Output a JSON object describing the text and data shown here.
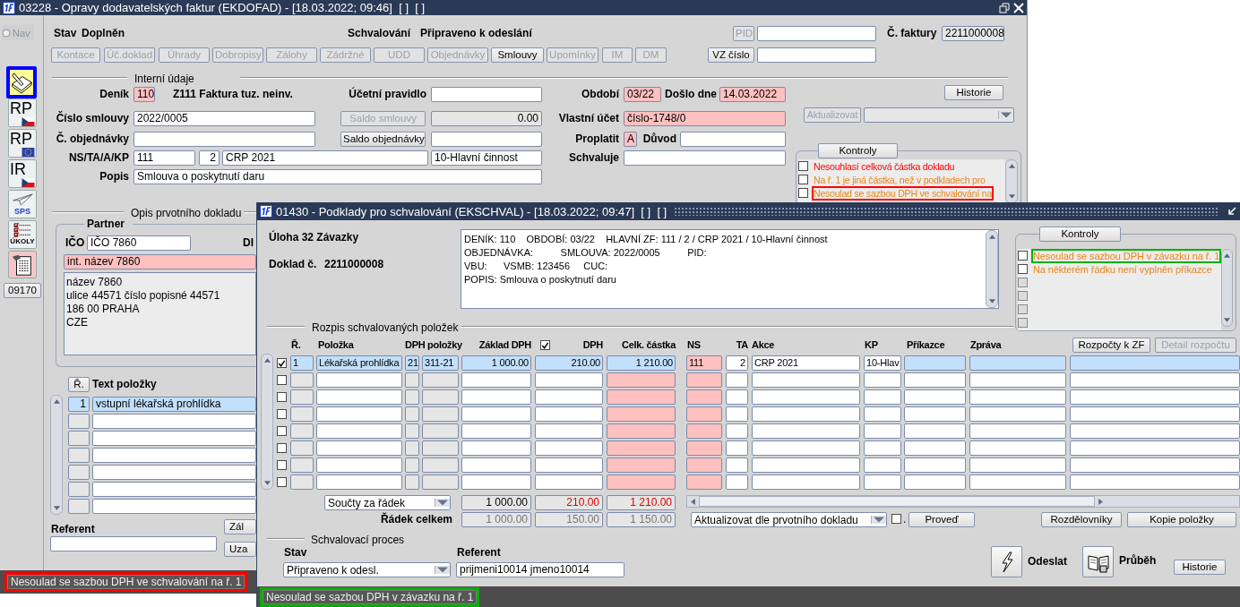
{
  "main_window": {
    "title": "03228 - Opravy dodavatelských faktur (EKDOFAD) - [18.03.2022; 09:46]  [ ]  [ ]",
    "highlight": {
      "color": "#ff0000"
    },
    "nav": {
      "label": "Nav",
      "disabled": true
    },
    "toolbar": [
      {
        "kind": "edit",
        "selected": true
      },
      {
        "kind": "czflag",
        "label": "RP",
        "selected": false
      },
      {
        "kind": "euflag",
        "label": "RP",
        "selected": false
      },
      {
        "kind": "czflag",
        "label": "IR",
        "selected": false
      },
      {
        "kind": "plane",
        "label": "SPS",
        "selected": false
      },
      {
        "kind": "tasks",
        "label": "ÚKOLY",
        "selected": false
      },
      {
        "kind": "document",
        "selected": false
      }
    ],
    "code_button": "09170",
    "stav": {
      "label": "Stav",
      "value": "Doplněn"
    },
    "schvalovani": {
      "label": "Schvalování",
      "value": "Připraveno k odeslání"
    },
    "pid": {
      "label": "PID",
      "disabled": true
    },
    "faktura": {
      "label": "Č. faktury",
      "value": "2211000008"
    },
    "vz_cislo": {
      "label": "VZ číslo",
      "disabled": false
    },
    "buttons": [
      {
        "label": "Kontace",
        "disabled": true
      },
      {
        "label": "Úč.doklad",
        "disabled": true
      },
      {
        "label": "Úhrady",
        "disabled": true
      },
      {
        "label": "Dobropisy",
        "disabled": true
      },
      {
        "label": "Zálohy",
        "disabled": true
      },
      {
        "label": "Zádržné",
        "disabled": true
      },
      {
        "label": "UDD",
        "disabled": true
      },
      {
        "label": "Objednávky",
        "disabled": true
      },
      {
        "label": "Smlouvy",
        "disabled": false
      },
      {
        "label": "Upomínky",
        "disabled": true
      },
      {
        "label": "IM",
        "disabled": true
      },
      {
        "label": "DM",
        "disabled": true
      }
    ],
    "section_internal": "Interní údaje",
    "denik": {
      "label": "Deník",
      "value": "110",
      "required": true,
      "description": "Z111 Faktura tuz. neinv."
    },
    "ucetni_pravidlo": {
      "label": "Účetní pravidlo"
    },
    "cislo_smlouvy": {
      "label": "Číslo smlouvy",
      "value": "2022/0005"
    },
    "saldo_smlouvy": {
      "label": "Saldo smlouvy",
      "value": "0.00",
      "disabled": true
    },
    "c_objednavky": {
      "label": "Č. objednávky"
    },
    "saldo_objednavky": {
      "label": "Saldo objednávky",
      "disabled": false
    },
    "ns_ta_a_kp": {
      "label": "NS/TA/A/KP",
      "values": [
        "111",
        "2",
        "CRP 2021",
        "10-Hlavní činnost"
      ]
    },
    "popis": {
      "label": "Popis",
      "value": "Smlouva o poskytnutí daru"
    },
    "obdobi": {
      "label": "Období",
      "value": "03/22",
      "required": true
    },
    "doslo_dne": {
      "label": "Došlo dne",
      "value": "14.03.2022",
      "required": true
    },
    "vlastni_ucet": {
      "label": "Vlastní účet",
      "value": "číslo-1748/0",
      "required": true
    },
    "proplatit": {
      "label": "Proplatit",
      "value": "A",
      "required": true
    },
    "duvod": {
      "label": "Důvod"
    },
    "schvaluje": {
      "label": "Schvaluje"
    },
    "historie_button": "Historie",
    "aktualizovat": {
      "label": "Aktualizovat",
      "disabled": true
    },
    "kontroly": {
      "button": "Kontroly",
      "items": [
        {
          "text": "Nesouhlasí celková částka dokladu",
          "color": "#ff0000",
          "checked": false,
          "disabled": false,
          "highlighted": false
        },
        {
          "text": "Na ř. 1 je jiná částka, než v podkladech pro",
          "color": "#e8861a",
          "checked": false,
          "disabled": false,
          "highlighted": false
        },
        {
          "text": "Nesoulad se sazbou DPH ve schvalování na",
          "color": "#e8861a",
          "checked": false,
          "disabled": false,
          "highlighted": true
        }
      ]
    },
    "section_opis": "Opis prvotního dokladu",
    "partner": {
      "title": "Partner",
      "ico_label": "IČO",
      "ico": "IČO 7860",
      "dic_label": "DI",
      "name": "int. název 7860",
      "required": true,
      "address": [
        "název 7860",
        "ulice 44571 číslo popisné 44571",
        "186 00 PRAHA",
        "CZE"
      ]
    },
    "items": {
      "columns": [
        "Ř.",
        "Text položky"
      ],
      "rows": [
        {
          "number": "1",
          "text": "vstupní lékařská prohlídka",
          "selected": true
        },
        {
          "selected": false
        },
        {
          "selected": false
        },
        {
          "selected": false
        },
        {
          "selected": false
        },
        {
          "selected": false
        },
        {
          "selected": false
        }
      ]
    },
    "referent_label": "Referent",
    "side_buttons": [
      "Zál",
      "Uza"
    ],
    "status_bar": {
      "text": "Nesoulad se sazbou DPH ve schvalování na ř. 1",
      "highlighted": true
    }
  },
  "approval_window": {
    "title": "01430 - Podklady pro schvalování (EKSCHVAL) - [18.03.2022; 09:47]  [ ]  [ ]",
    "highlight": {
      "color": "#00b000"
    },
    "task": "Úloha 32 Závazky",
    "doklad": {
      "label": "Doklad č.",
      "value": "2211000008"
    },
    "info_lines": [
      "DENÍK: 110    OBDOBÍ: 03/22    HLAVNÍ ZF: 111 / 2 / CRP 2021 / 10-Hlavní činnost",
      "OBJEDNÁVKA:          SMLOUVA: 2022/0005          PID:",
      "VBU:      VSMB: 123456     CUC:",
      "POPIS: Smlouva o poskytnutí daru"
    ],
    "kontroly": {
      "button": "Kontroly",
      "items": [
        {
          "text": "Nesoulad se sazbou DPH v závazku na ř. 1",
          "color": "#e8861a",
          "checked": false,
          "disabled": false,
          "highlighted": true
        },
        {
          "text": "Na některém řádku není vyplněn příkazce",
          "color": "#e8861a",
          "checked": false,
          "disabled": false,
          "highlighted": false
        },
        {
          "checked": false,
          "disabled": true,
          "highlighted": false
        },
        {
          "checked": false,
          "disabled": true,
          "highlighted": false
        },
        {
          "checked": false,
          "disabled": true,
          "highlighted": false
        },
        {
          "checked": false,
          "disabled": true,
          "highlighted": false
        }
      ]
    },
    "section_items": "Rozpis schvalovaných položek",
    "table": {
      "columns": [
        {
          "label": "Ř.",
          "kind": "index"
        },
        {
          "label": "Položka",
          "kind": "detail"
        },
        {
          "label": "DPH položky",
          "kind": "vat"
        },
        {
          "kind": "vat"
        },
        {
          "label": "Základ DPH",
          "kind": "detail"
        },
        {
          "label": "DPH",
          "kind": "detail"
        },
        {
          "label": "Celk. částka",
          "kind": "total"
        },
        {
          "label": "NS",
          "kind": "code"
        },
        {
          "label": "TA",
          "kind": "entry"
        },
        {
          "label": "Akce",
          "kind": "entry"
        },
        {
          "label": "KP",
          "kind": "entry"
        },
        {
          "label": "Příkazce",
          "kind": "detail"
        },
        {
          "label": "Zpráva",
          "kind": "detail"
        },
        {
          "kind": "detail"
        }
      ],
      "vat_header_checked": true,
      "rows": [
        {
          "checked": true,
          "selected": true,
          "cells": [
            "1",
            "Lékařská prohlídka",
            "21",
            "311-21",
            "1 000.00",
            "210.00",
            "1 210.00",
            "111",
            "2",
            "CRP 2021",
            "10-Hlav"
          ]
        },
        {
          "checked": false,
          "selected": false
        },
        {
          "checked": false,
          "selected": false
        },
        {
          "checked": false,
          "selected": false
        },
        {
          "checked": false,
          "selected": false
        },
        {
          "checked": false,
          "selected": false
        },
        {
          "checked": false,
          "selected": false
        },
        {
          "checked": false,
          "selected": false
        }
      ]
    },
    "budget_buttons": [
      {
        "label": "Rozpočty k ZF",
        "disabled": false
      },
      {
        "label": "Detail rozpočtu",
        "disabled": true
      }
    ],
    "sums": {
      "mode": "Součty za řádek",
      "values": [
        {
          "value": "1 000.00",
          "mismatch": false
        },
        {
          "value": "210.00",
          "mismatch": true
        },
        {
          "value": "1 210.00",
          "mismatch": true
        }
      ]
    },
    "row_total": {
      "label": "Řádek celkem",
      "values": [
        "1 000.00",
        "150.00",
        "1 150.00"
      ]
    },
    "update": {
      "mode": "Aktualizovat dle prvotního dokladu",
      "checked": false,
      "check_label": ".",
      "button": "Proveď"
    },
    "action_buttons": [
      "Rozdělovníky",
      "Kopie položky"
    ],
    "section_process": "Schvalovací proces",
    "stav": {
      "label": "Stav",
      "value": "Připraveno k odesl."
    },
    "referent": {
      "label": "Referent",
      "value": "prijmeni10014 jmeno10014"
    },
    "odeslat": "Odeslat",
    "prubeh": "Průběh",
    "historie_button": "Historie",
    "status_bar": {
      "text": "Nesoulad se sazbou DPH v závazku na ř. 1",
      "highlighted": true
    }
  }
}
